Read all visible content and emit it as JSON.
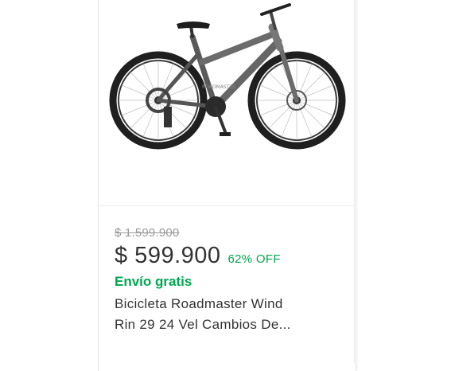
{
  "product": {
    "image_alt": "Bicicleta Roadmaster Wind Rin 29",
    "original_price": "$ 1.599.900",
    "price": "$ 599.900",
    "discount": "62% OFF",
    "shipping": "Envío gratis",
    "title_line1": "Bicicleta Roadmaster Wind",
    "title_line2": "Rin 29 24 Vel Cambios De..."
  },
  "colors": {
    "accent_green": "#00a650",
    "text_primary": "#333333",
    "text_muted": "#999999"
  }
}
